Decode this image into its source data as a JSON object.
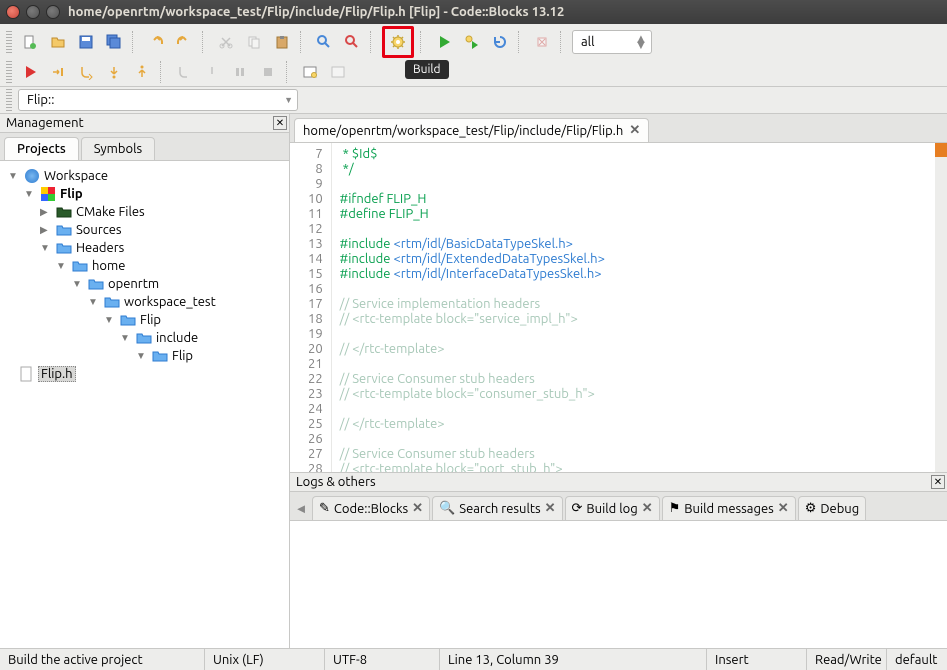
{
  "window": {
    "title": "home/openrtm/workspace_test/Flip/include/Flip/Flip.h [Flip] - Code::Blocks 13.12"
  },
  "tooltip": "Build",
  "target": "all",
  "scope": "Flip::",
  "management": {
    "title": "Management",
    "tabs": [
      "Projects",
      "Symbols"
    ],
    "tree": [
      {
        "label": "Workspace",
        "depth": 1,
        "icon": "workspace",
        "expanded": true
      },
      {
        "label": "Flip",
        "depth": 2,
        "icon": "project",
        "expanded": true,
        "bold": true
      },
      {
        "label": "CMake Files",
        "depth": 3,
        "icon": "folder-dark",
        "expanded": false
      },
      {
        "label": "Sources",
        "depth": 3,
        "icon": "folder",
        "expanded": false
      },
      {
        "label": "Headers",
        "depth": 3,
        "icon": "folder",
        "expanded": true
      },
      {
        "label": "home",
        "depth": 4,
        "icon": "folder",
        "expanded": true
      },
      {
        "label": "openrtm",
        "depth": 5,
        "icon": "folder",
        "expanded": true
      },
      {
        "label": "workspace_test",
        "depth": 6,
        "icon": "folder",
        "expanded": true
      },
      {
        "label": "Flip",
        "depth": 7,
        "icon": "folder",
        "expanded": true
      },
      {
        "label": "include",
        "depth": 8,
        "icon": "folder",
        "expanded": true
      },
      {
        "label": "Flip",
        "depth": 9,
        "icon": "folder",
        "expanded": true
      },
      {
        "label": "Flip.h",
        "depth": 10,
        "icon": "file",
        "selected": true
      }
    ]
  },
  "editor": {
    "tab_title": "home/openrtm/workspace_test/Flip/include/Flip/Flip.h",
    "first_line": 7,
    "lines": [
      {
        "n": 7,
        "cls": "c-comment",
        "text": " * $Id$"
      },
      {
        "n": 8,
        "cls": "c-comment",
        "text": " */"
      },
      {
        "n": 9,
        "cls": "",
        "text": ""
      },
      {
        "n": 10,
        "cls": "c-keyword",
        "text": "#ifndef FLIP_H"
      },
      {
        "n": 11,
        "cls": "c-keyword",
        "text": "#define FLIP_H"
      },
      {
        "n": 12,
        "cls": "",
        "text": ""
      },
      {
        "n": 13,
        "cls": "",
        "text": "#include <rtm/idl/BasicDataTypeSkel.h>",
        "mixed": true,
        "kw": "#include ",
        "str": "<rtm/idl/BasicDataTypeSkel.h>"
      },
      {
        "n": 14,
        "cls": "",
        "text": "#include <rtm/idl/ExtendedDataTypesSkel.h>",
        "mixed": true,
        "kw": "#include ",
        "str": "<rtm/idl/ExtendedDataTypesSkel.h>"
      },
      {
        "n": 15,
        "cls": "",
        "text": "#include <rtm/idl/InterfaceDataTypesSkel.h>",
        "mixed": true,
        "kw": "#include ",
        "str": "<rtm/idl/InterfaceDataTypesSkel.h>"
      },
      {
        "n": 16,
        "cls": "",
        "text": ""
      },
      {
        "n": 17,
        "cls": "c-comment-light",
        "text": "// Service implementation headers"
      },
      {
        "n": 18,
        "cls": "c-comment-light",
        "text": "// <rtc-template block=\"service_impl_h\">"
      },
      {
        "n": 19,
        "cls": "",
        "text": ""
      },
      {
        "n": 20,
        "cls": "c-comment-light",
        "text": "// </rtc-template>"
      },
      {
        "n": 21,
        "cls": "",
        "text": ""
      },
      {
        "n": 22,
        "cls": "c-comment-light",
        "text": "// Service Consumer stub headers"
      },
      {
        "n": 23,
        "cls": "c-comment-light",
        "text": "// <rtc-template block=\"consumer_stub_h\">"
      },
      {
        "n": 24,
        "cls": "",
        "text": ""
      },
      {
        "n": 25,
        "cls": "c-comment-light",
        "text": "// </rtc-template>"
      },
      {
        "n": 26,
        "cls": "",
        "text": ""
      },
      {
        "n": 27,
        "cls": "c-comment-light",
        "text": "// Service Consumer stub headers"
      },
      {
        "n": 28,
        "cls": "c-comment-light",
        "text": "// <rtc-template block=\"port_stub_h\">"
      }
    ]
  },
  "logs": {
    "title": "Logs & others",
    "tabs": [
      {
        "label": "Code::Blocks",
        "icon": "edit"
      },
      {
        "label": "Search results",
        "icon": "search"
      },
      {
        "label": "Build log",
        "icon": "refresh"
      },
      {
        "label": "Build messages",
        "icon": "flag"
      },
      {
        "label": "Debug",
        "icon": "gear",
        "trunc": true
      }
    ]
  },
  "status": {
    "hint": "Build the active project",
    "eol": "Unix (LF)",
    "enc": "UTF-8",
    "pos": "Line 13, Column 39",
    "ovr": "Insert",
    "rw": "Read/Write",
    "conf": "default"
  }
}
